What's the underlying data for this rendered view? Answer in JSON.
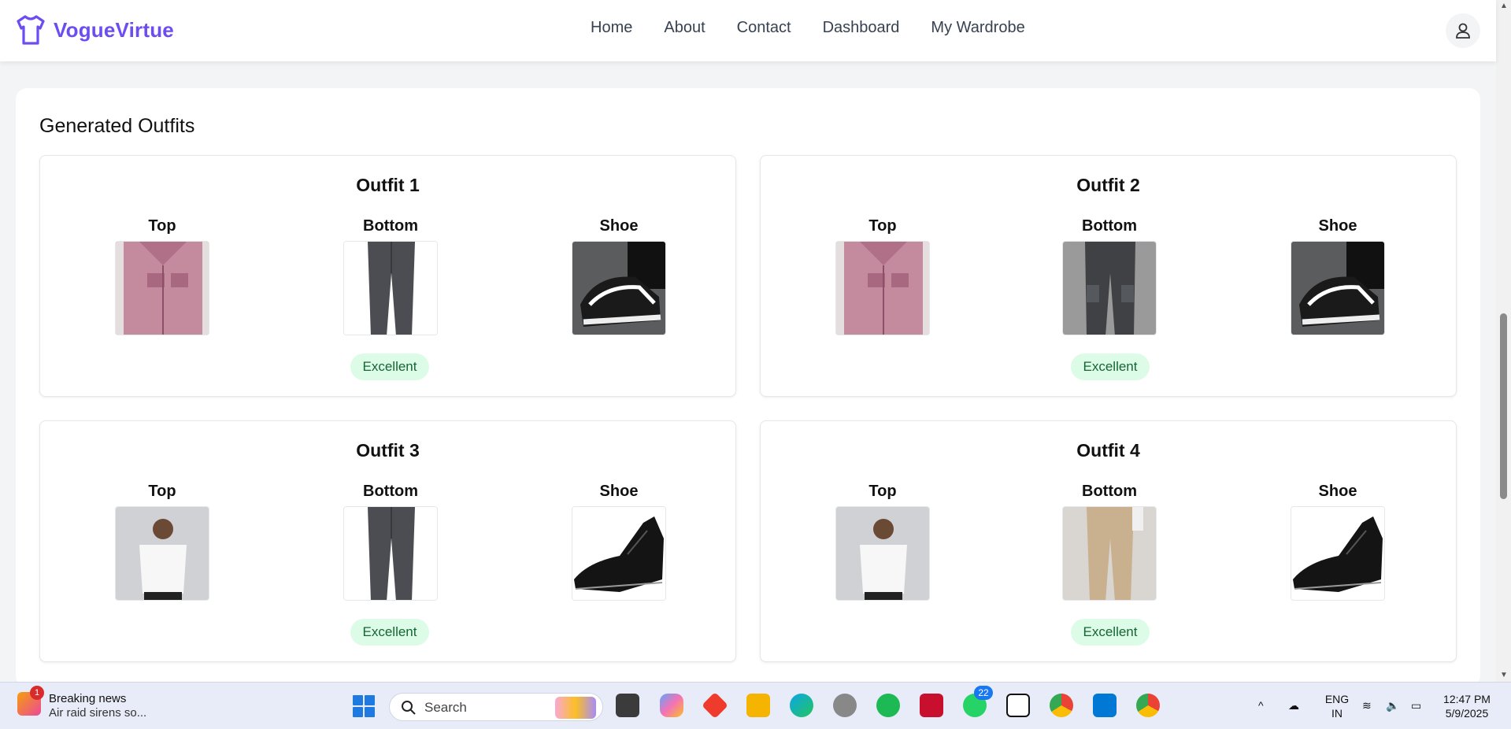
{
  "app": {
    "brand_name": "VogueVirtue"
  },
  "nav": {
    "items": [
      "Home",
      "About",
      "Contact",
      "Dashboard",
      "My Wardrobe"
    ]
  },
  "section": {
    "title": "Generated Outfits"
  },
  "labels": {
    "top": "Top",
    "bottom": "Bottom",
    "shoe": "Shoe"
  },
  "outfits": [
    {
      "name": "Outfit 1",
      "top": "pink-shirt",
      "bottom": "gray-trousers",
      "shoe": "patterned-sneakers",
      "rating": "Excellent"
    },
    {
      "name": "Outfit 2",
      "top": "pink-shirt",
      "bottom": "cargo-pants",
      "shoe": "patterned-sneakers",
      "rating": "Excellent"
    },
    {
      "name": "Outfit 3",
      "top": "white-tshirt",
      "bottom": "gray-trousers",
      "shoe": "black-oxford",
      "rating": "Excellent"
    },
    {
      "name": "Outfit 4",
      "top": "white-tshirt",
      "bottom": "beige-chinos",
      "shoe": "black-oxford",
      "rating": "Excellent"
    }
  ],
  "colors": {
    "brand": "#6d4df2",
    "badge_bg": "#dcfce7",
    "badge_text": "#166534"
  },
  "taskbar": {
    "news_title": "Breaking news",
    "news_subtitle": "Air raid sirens so...",
    "news_count": "1",
    "search_label": "Search",
    "whatsapp_count": "22",
    "lang_line1": "ENG",
    "lang_line2": "IN",
    "time": "12:47 PM",
    "date": "5/9/2025"
  }
}
